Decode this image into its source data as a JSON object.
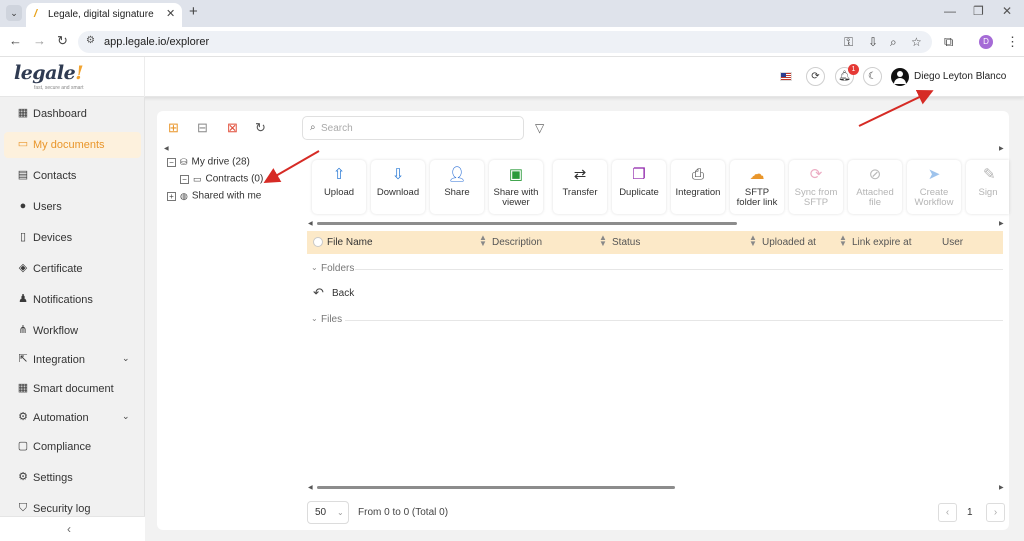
{
  "browser": {
    "tab_title": "Legale, digital signature",
    "url": "app.legale.io/explorer",
    "profile_initial": "D"
  },
  "app": {
    "logo_text": "legale",
    "logo_tagline": "fast, secure and smart",
    "user_name": "Diego Leyton Blanco",
    "notification_count": "1",
    "accent_color": "#e9962b"
  },
  "sidebar": {
    "items": [
      {
        "label": "Dashboard",
        "icon": "dashboard-icon"
      },
      {
        "label": "My documents",
        "icon": "folder-icon",
        "active": true
      },
      {
        "label": "Contacts",
        "icon": "contacts-icon"
      },
      {
        "label": "Users",
        "icon": "user-icon"
      },
      {
        "label": "Devices",
        "icon": "device-icon"
      },
      {
        "label": "Certificate",
        "icon": "certificate-icon"
      },
      {
        "label": "Notifications",
        "icon": "bell-icon"
      },
      {
        "label": "Workflow",
        "icon": "workflow-icon"
      },
      {
        "label": "Integration",
        "icon": "integration-icon",
        "expandable": true
      },
      {
        "label": "Smart document",
        "icon": "smart-document-icon"
      },
      {
        "label": "Automation",
        "icon": "automation-icon",
        "expandable": true
      },
      {
        "label": "Compliance",
        "icon": "compliance-icon"
      },
      {
        "label": "Settings",
        "icon": "gear-icon"
      },
      {
        "label": "Security log",
        "icon": "shield-icon"
      }
    ],
    "collapse_glyph": "‹"
  },
  "explorer": {
    "search_placeholder": "Search",
    "tree": [
      {
        "label": "My drive (28)",
        "toggle": "−"
      },
      {
        "label": "Contracts (0)",
        "toggle": "−"
      },
      {
        "label": "Shared with me",
        "toggle": "+"
      }
    ],
    "actions": [
      {
        "label": "Upload",
        "icon": "upload-icon",
        "enabled": true
      },
      {
        "label": "Download",
        "icon": "download-icon",
        "enabled": true
      },
      {
        "label": "Share",
        "icon": "share-user-icon",
        "enabled": true
      },
      {
        "label": "Share with viewer",
        "icon": "share-viewer-icon",
        "enabled": true
      },
      {
        "label": "Transfer",
        "icon": "transfer-icon",
        "enabled": true
      },
      {
        "label": "Duplicate",
        "icon": "duplicate-icon",
        "enabled": true
      },
      {
        "label": "Integration",
        "icon": "integration-icon",
        "enabled": true
      },
      {
        "label": "SFTP folder link",
        "icon": "cloud-link-icon",
        "enabled": true
      },
      {
        "label": "Sync from SFTP",
        "icon": "sync-icon",
        "enabled": false
      },
      {
        "label": "Attached file",
        "icon": "paperclip-icon",
        "enabled": false
      },
      {
        "label": "Create Workflow",
        "icon": "send-icon",
        "enabled": false
      },
      {
        "label": "Sign",
        "icon": "sign-icon",
        "enabled": false
      }
    ],
    "columns": [
      "File Name",
      "Description",
      "Status",
      "Uploaded at",
      "Link expire at",
      "User"
    ],
    "groups": {
      "folders": "Folders",
      "files": "Files"
    },
    "back_label": "Back",
    "page_size": "50",
    "range_text": "From 0 to 0 (Total 0)",
    "current_page": "1"
  }
}
